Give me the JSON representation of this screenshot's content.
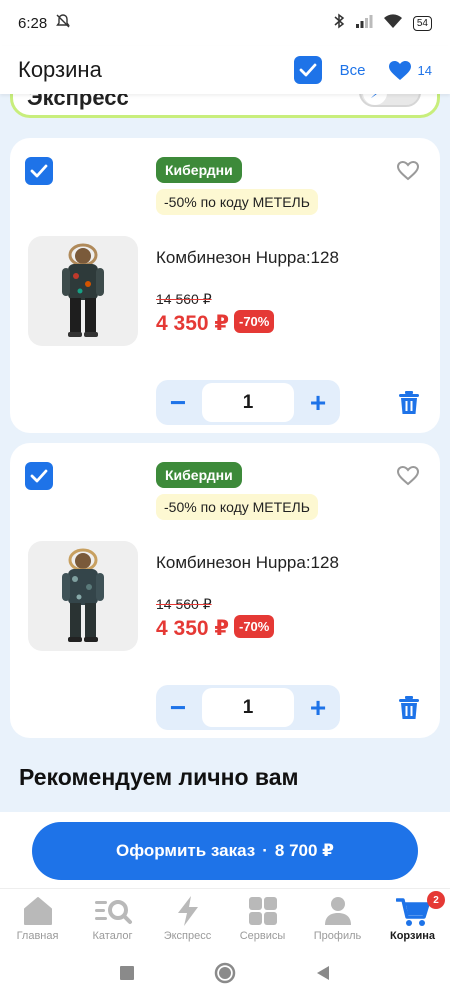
{
  "status": {
    "time": "6:28",
    "battery": "54"
  },
  "header": {
    "title": "Корзина",
    "select_all_label": "Все",
    "favorites_count": "14"
  },
  "express": {
    "label": "Экспресс"
  },
  "items": [
    {
      "seller": "Кибердни",
      "promo": "-50% по коду МЕТЕЛЬ",
      "name": "Комбинезон Huppa:128",
      "old_price": "14 560 ₽",
      "price": "4 350 ₽",
      "discount": "-70%",
      "quantity": "1",
      "decrement": "−",
      "increment": "+"
    },
    {
      "seller": "Кибердни",
      "promo": "-50% по коду МЕТЕЛЬ",
      "name": "Комбинезон Huppa:128",
      "old_price": "14 560 ₽",
      "price": "4 350 ₽",
      "discount": "-70%",
      "quantity": "1",
      "decrement": "−",
      "increment": "+"
    }
  ],
  "recommend": {
    "title": "Рекомендуем лично вам"
  },
  "checkout": {
    "label": "Оформить заказ",
    "separator": "·",
    "total": "8 700 ₽"
  },
  "tabs": [
    {
      "label": "Главная",
      "icon": "home-icon"
    },
    {
      "label": "Каталог",
      "icon": "catalog-search-icon"
    },
    {
      "label": "Экспресс",
      "icon": "lightning-icon"
    },
    {
      "label": "Сервисы",
      "icon": "services-icon"
    },
    {
      "label": "Профиль",
      "icon": "profile-icon"
    },
    {
      "label": "Корзина",
      "icon": "cart-icon",
      "badge": "2"
    }
  ],
  "colors": {
    "accent": "#1e73e8",
    "sale": "#e53935",
    "seller_badge": "#3d8a3a",
    "promo_bg": "#fdf8d2",
    "content_bg": "#e9f2fb"
  }
}
